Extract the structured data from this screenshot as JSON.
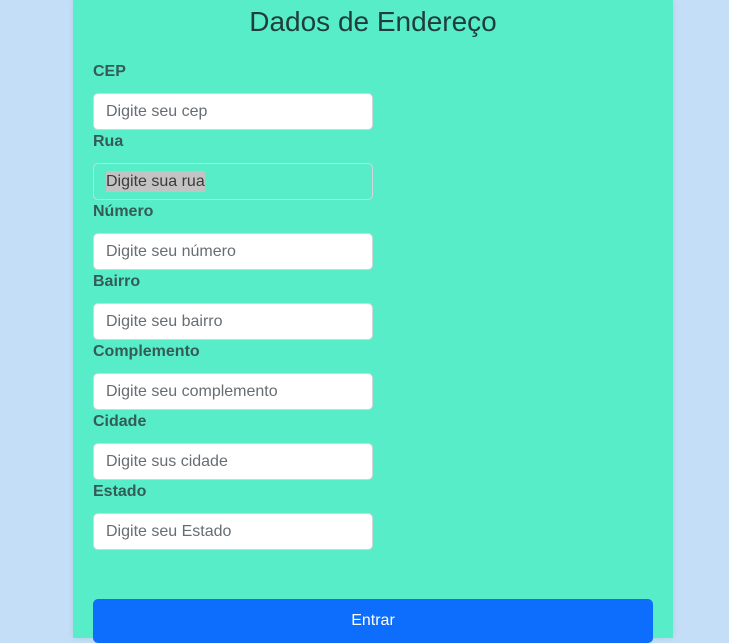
{
  "form": {
    "title": "Dados de Endereço",
    "fields": [
      {
        "label": "CEP",
        "placeholder": "Digite seu cep",
        "value": ""
      },
      {
        "label": "Rua",
        "placeholder": "Digite sua rua",
        "value": ""
      },
      {
        "label": "Número",
        "placeholder": "Digite seu número",
        "value": ""
      },
      {
        "label": "Bairro",
        "placeholder": "Digite seu bairro",
        "value": ""
      },
      {
        "label": "Complemento",
        "placeholder": "Digite seu complemento",
        "value": ""
      },
      {
        "label": "Cidade",
        "placeholder": "Digite sus cidade",
        "value": ""
      },
      {
        "label": "Estado",
        "placeholder": "Digite seu Estado",
        "value": ""
      }
    ],
    "submit_label": "Entrar"
  },
  "colors": {
    "page_background": "#c4def8",
    "card_background": "#58edc9",
    "button_background": "#0d6efd",
    "label_text": "#345b55"
  }
}
